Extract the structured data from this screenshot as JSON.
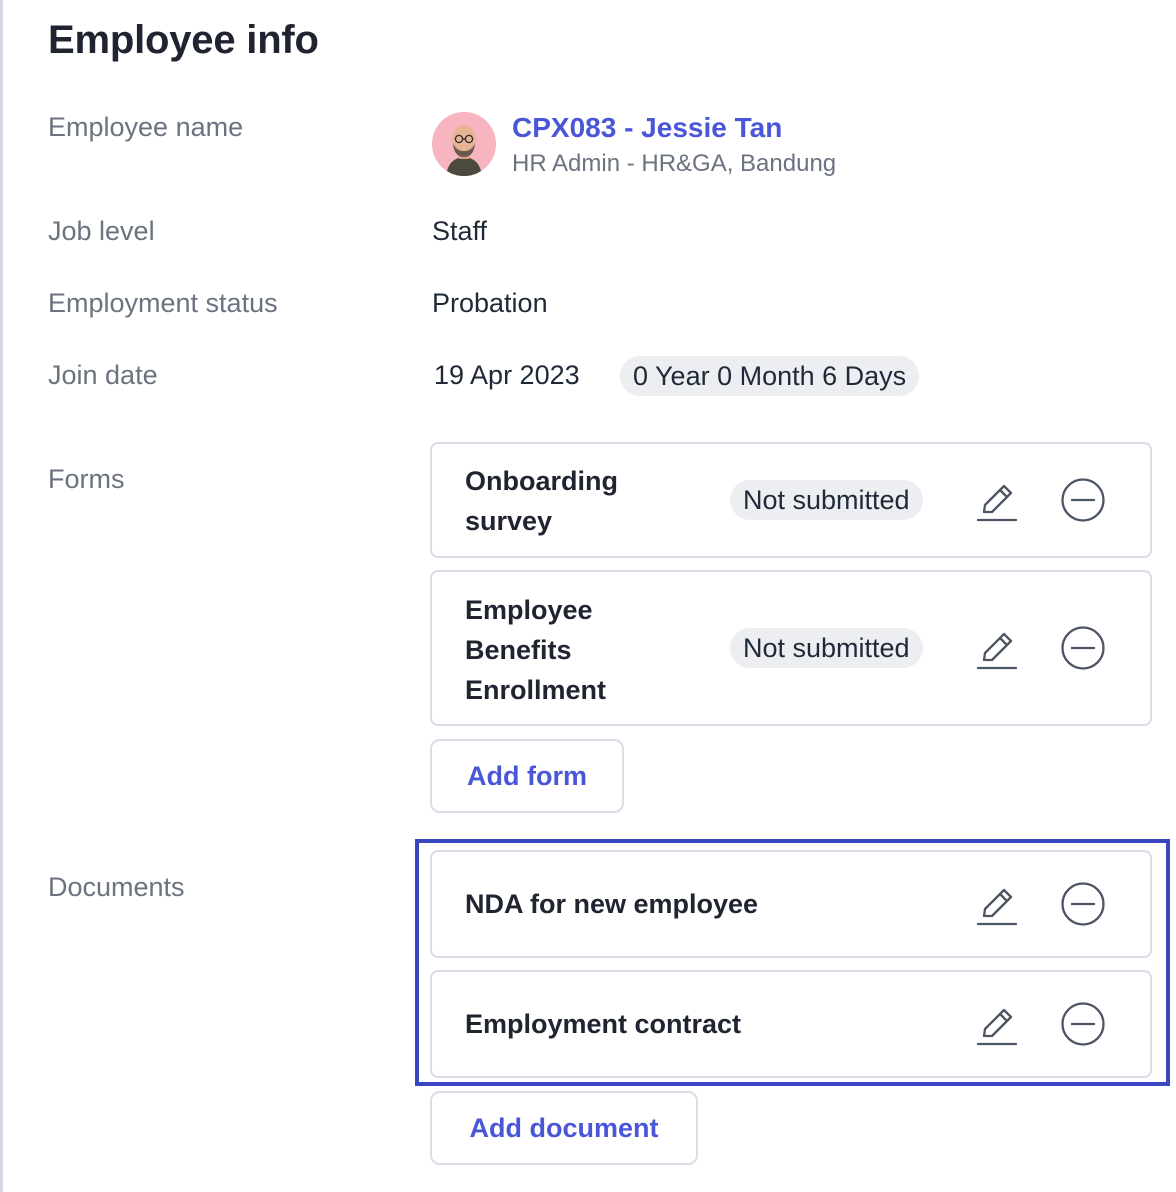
{
  "section": {
    "title": "Employee info"
  },
  "labels": {
    "employee_name": "Employee name",
    "job_level": "Job level",
    "employment_status": "Employment status",
    "join_date": "Join date",
    "forms": "Forms",
    "documents": "Documents"
  },
  "employee": {
    "name_link": "CPX083 - Jessie Tan",
    "subtitle": "HR Admin - HR&GA, Bandung",
    "job_level": "Staff",
    "employment_status": "Probation",
    "join_date": "19 Apr 2023",
    "tenure": "0 Year 0 Month 6 Days"
  },
  "forms": [
    {
      "title_lines": [
        "Onboarding",
        "survey"
      ],
      "status": "Not submitted"
    },
    {
      "title_lines": [
        "Employee",
        "Benefits",
        "Enrollment"
      ],
      "status": "Not submitted"
    }
  ],
  "add_form_label": "Add form",
  "documents": [
    {
      "title": "NDA for new employee"
    },
    {
      "title": "Employment contract"
    }
  ],
  "add_document_label": "Add document",
  "icons": {
    "edit": "pencil-icon",
    "remove": "minus-circle-icon"
  },
  "colors": {
    "link": "#4a56d8",
    "highlight": "#3a45c2",
    "pill_bg": "#eceef2"
  }
}
